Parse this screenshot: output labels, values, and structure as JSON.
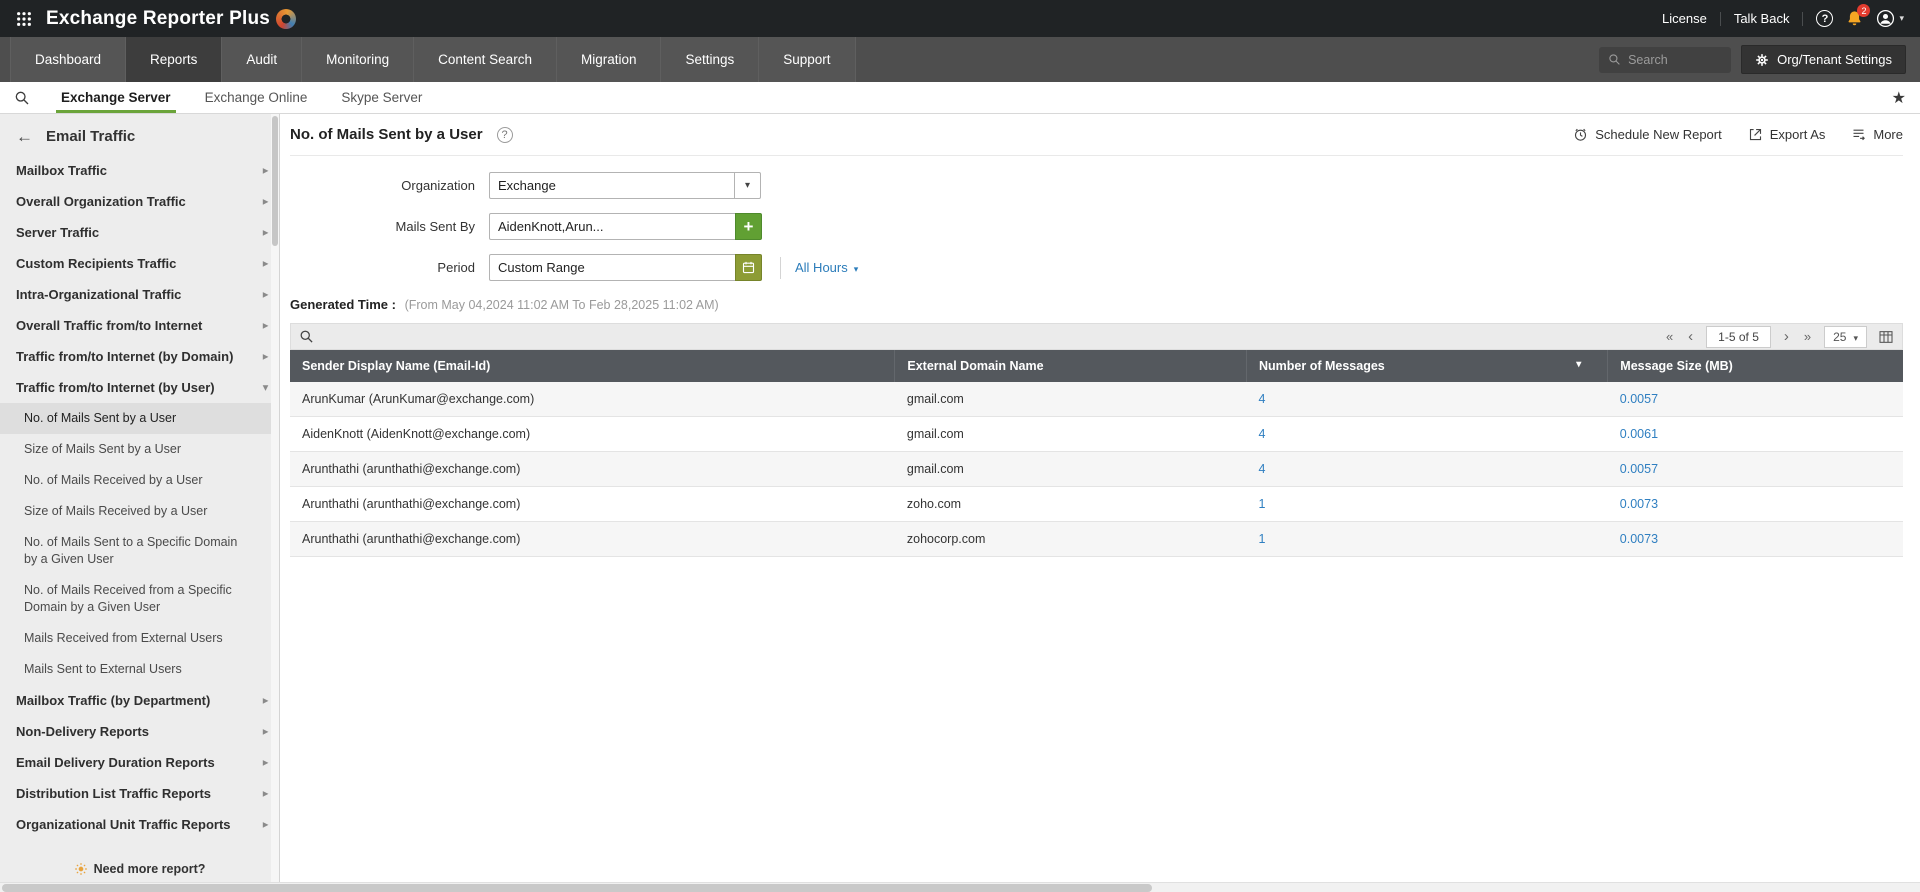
{
  "colors": {
    "accent_green": "#6ba43a",
    "link_blue": "#2f7fc1",
    "table_header_gray": "#54585d",
    "notification_red": "#e23b2e"
  },
  "icons": {
    "apps-icon": "3x3-dot-grid",
    "help-icon": "?",
    "bell-icon": "bell",
    "user-icon": "person-circle",
    "search-icon": "magnifier",
    "gear-icon": "gear",
    "star-icon": "★",
    "back-arrow-icon": "←",
    "chevron-right-icon": "▸",
    "chevron-down-icon": "▾",
    "schedule-icon": "alarm-clock",
    "export-icon": "box-arrow",
    "more-icon": "list-arrow",
    "calendar-icon": "calendar",
    "plus-icon": "+",
    "columns-icon": "table-grid",
    "pagination-icons": [
      "«",
      "‹",
      "›",
      "»"
    ],
    "need-more-icon": "sunburst"
  },
  "topbar": {
    "app_title": "Exchange Reporter Plus",
    "license_label": "License",
    "talkback_label": "Talk Back",
    "notification_count": "2"
  },
  "nav": {
    "tabs": [
      {
        "label": "Dashboard"
      },
      {
        "label": "Reports",
        "active": true
      },
      {
        "label": "Audit"
      },
      {
        "label": "Monitoring"
      },
      {
        "label": "Content Search"
      },
      {
        "label": "Migration"
      },
      {
        "label": "Settings"
      },
      {
        "label": "Support"
      }
    ],
    "search_placeholder": "Search",
    "org_settings_label": "Org/Tenant Settings"
  },
  "subnav": {
    "tabs": [
      {
        "label": "Exchange Server",
        "active": true
      },
      {
        "label": "Exchange Online"
      },
      {
        "label": "Skype Server"
      }
    ]
  },
  "sidebar": {
    "back_label": "Email Traffic",
    "items": [
      {
        "label": "Mailbox Traffic",
        "type": "group"
      },
      {
        "label": "Overall Organization Traffic",
        "type": "group"
      },
      {
        "label": "Server Traffic",
        "type": "group"
      },
      {
        "label": "Custom Recipients Traffic",
        "type": "group"
      },
      {
        "label": "Intra-Organizational Traffic",
        "type": "group"
      },
      {
        "label": "Overall Traffic from/to Internet",
        "type": "group"
      },
      {
        "label": "Traffic from/to Internet (by Domain)",
        "type": "group"
      },
      {
        "label": "Traffic from/to Internet (by User)",
        "type": "group",
        "expanded": true
      },
      {
        "label": "No. of Mails Sent by a User",
        "type": "child",
        "selected": true
      },
      {
        "label": "Size of Mails Sent by a User",
        "type": "child"
      },
      {
        "label": "No. of Mails Received by a User",
        "type": "child"
      },
      {
        "label": "Size of Mails Received by a User",
        "type": "child"
      },
      {
        "label": "No. of Mails Sent to a Specific Domain by a Given User",
        "type": "child"
      },
      {
        "label": "No. of Mails Received from a Specific Domain by a Given User",
        "type": "child"
      },
      {
        "label": "Mails Received from External Users",
        "type": "child"
      },
      {
        "label": "Mails Sent to External Users",
        "type": "child"
      },
      {
        "label": "Mailbox Traffic (by Department)",
        "type": "group"
      },
      {
        "label": "Non-Delivery Reports",
        "type": "group"
      },
      {
        "label": "Email Delivery Duration Reports",
        "type": "group"
      },
      {
        "label": "Distribution List Traffic Reports",
        "type": "group"
      },
      {
        "label": "Organizational Unit Traffic Reports",
        "type": "group"
      }
    ],
    "footer_link": "Need more report?"
  },
  "report": {
    "title": "No. of Mails Sent by a User",
    "actions": {
      "schedule": "Schedule New Report",
      "export": "Export As",
      "more": "More"
    },
    "form": {
      "organization_label": "Organization",
      "organization_value": "Exchange",
      "mails_sent_by_label": "Mails Sent By",
      "mails_sent_by_value": "AidenKnott,Arun...",
      "period_label": "Period",
      "period_value": "Custom Range",
      "all_hours_label": "All Hours"
    },
    "generated_label": "Generated Time :",
    "generated_value": "(From May 04,2024 11:02 AM To Feb 28,2025 11:02 AM)",
    "toolbar": {
      "range": "1-5 of 5",
      "page_size": "25"
    },
    "table": {
      "columns": [
        "Sender Display Name (Email-Id)",
        "External Domain Name",
        "Number of Messages",
        "Message Size (MB)"
      ],
      "rows": [
        {
          "sender": "ArunKumar (ArunKumar@exchange.com)",
          "domain": "gmail.com",
          "messages": "4",
          "size": "0.0057"
        },
        {
          "sender": "AidenKnott (AidenKnott@exchange.com)",
          "domain": "gmail.com",
          "messages": "4",
          "size": "0.0061"
        },
        {
          "sender": "Arunthathi (arunthathi@exchange.com)",
          "domain": "gmail.com",
          "messages": "4",
          "size": "0.0057"
        },
        {
          "sender": "Arunthathi (arunthathi@exchange.com)",
          "domain": "zoho.com",
          "messages": "1",
          "size": "0.0073"
        },
        {
          "sender": "Arunthathi (arunthathi@exchange.com)",
          "domain": "zohocorp.com",
          "messages": "1",
          "size": "0.0073"
        }
      ]
    }
  }
}
